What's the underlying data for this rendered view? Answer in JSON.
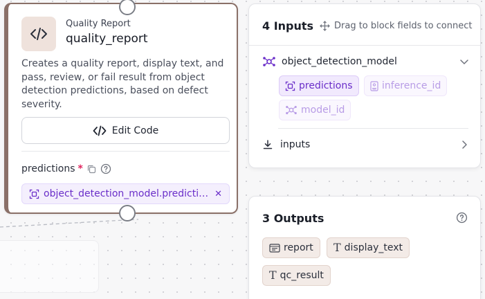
{
  "node": {
    "kind": "Quality Report",
    "title": "quality_report",
    "icon": "code-icon",
    "description": "Creates a quality report, display text, and pass, review, or fail result from object detection predictions, based on defect severity.",
    "edit_label": "Edit Code",
    "field": {
      "label": "predictions",
      "required": "*",
      "value": "object_detection_model.predictions"
    }
  },
  "inputs_panel": {
    "title": "4 Inputs",
    "hint": "Drag to block fields to connect",
    "model": {
      "label": "object_detection_model",
      "fields": [
        "predictions",
        "inference_id",
        "model_id"
      ]
    },
    "inputs_label": "inputs"
  },
  "outputs_panel": {
    "title": "3 Outputs",
    "outputs": [
      "report",
      "display_text",
      "qc_result"
    ]
  },
  "colors": {
    "accent_purple": "#6a2ec9",
    "node_border": "#8a7068",
    "output_chip": "#f3ebe7"
  }
}
